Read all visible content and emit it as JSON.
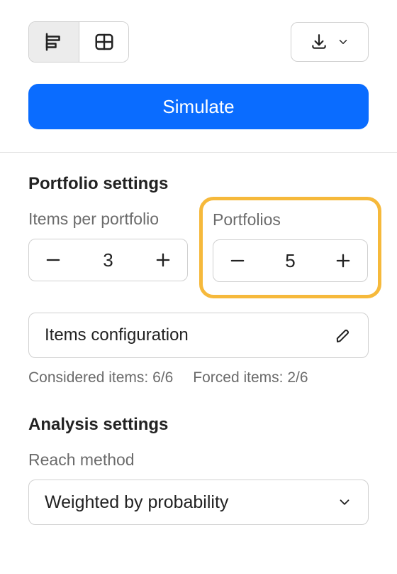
{
  "simulate_label": "Simulate",
  "portfolio_settings": {
    "title": "Portfolio settings",
    "items_per_portfolio": {
      "label": "Items per portfolio",
      "value": "3"
    },
    "portfolios": {
      "label": "Portfolios",
      "value": "5"
    },
    "items_configuration_label": "Items configuration",
    "considered_items_text": "Considered items: 6/6",
    "forced_items_text": "Forced items: 2/6"
  },
  "analysis_settings": {
    "title": "Analysis settings",
    "reach_method_label": "Reach method",
    "reach_method_value": "Weighted by probability"
  }
}
